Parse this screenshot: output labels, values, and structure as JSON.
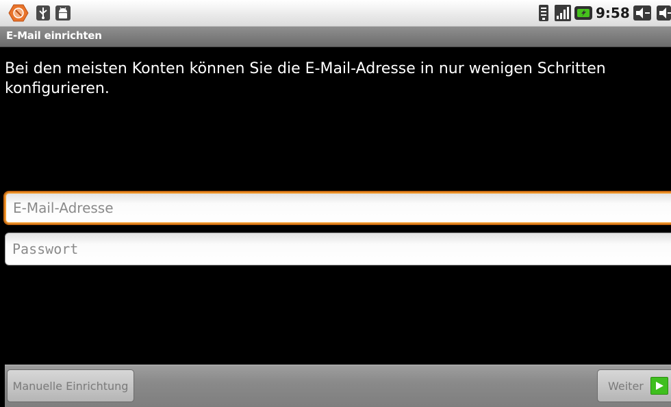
{
  "status_bar": {
    "time": "9:58",
    "icons": [
      "alert-triangle-icon",
      "usb-icon",
      "android-debug-icon",
      "wifi-icon",
      "signal-icon",
      "battery-icon",
      "volume-down-icon",
      "volume-up-icon"
    ]
  },
  "title_bar": {
    "title": "E-Mail einrichten"
  },
  "intro": {
    "text": "Bei den meisten Konten können Sie die E-Mail-Adresse in nur wenigen Schritten konfigurieren."
  },
  "form": {
    "email_placeholder": "E-Mail-Adresse",
    "email_value": "",
    "password_placeholder": "Passwort",
    "password_value": ""
  },
  "buttons": {
    "manual_label": "Manuelle Einrichtung",
    "next_label": "Weiter"
  },
  "colors": {
    "focus_border": "#f29a2e",
    "next_arrow": "#3fbf1f",
    "notification": "#e9742b"
  }
}
